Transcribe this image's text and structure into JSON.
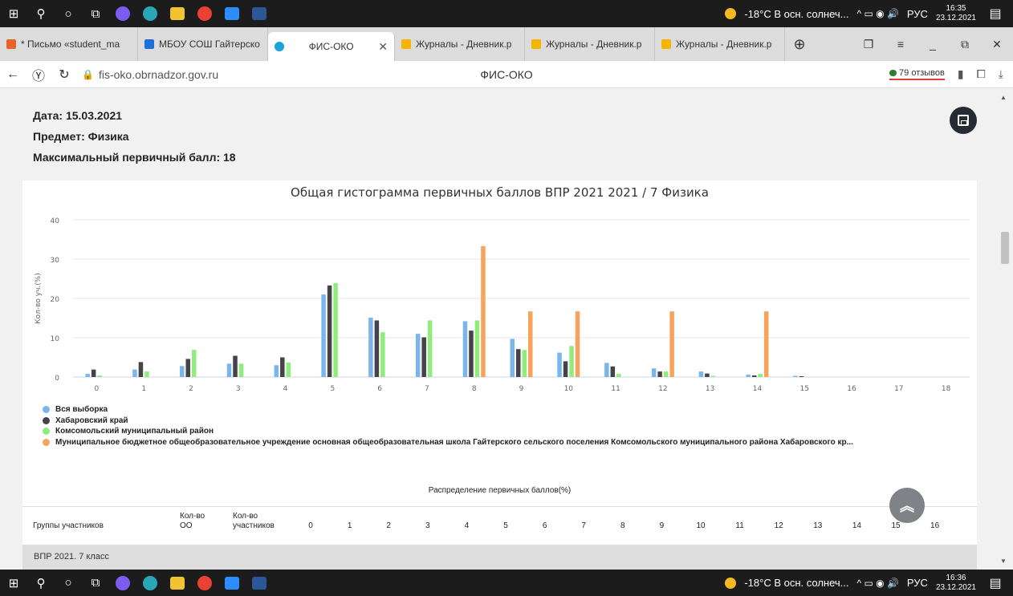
{
  "taskbar": {
    "weather": "-18°C В осн. солнеч...",
    "lang": "РУС",
    "top_time": "16:35",
    "top_date": "23.12.2021",
    "bottom_time": "16:36",
    "bottom_date": "23.12.2021"
  },
  "tabs": [
    {
      "label": "* Письмо «student_ma",
      "color": "#e8632b"
    },
    {
      "label": "МБОУ СОШ Гайтерско",
      "color": "#1e6fd9"
    },
    {
      "label": "ФИС-ОКО",
      "color": "#1aa3d8",
      "active": true
    },
    {
      "label": "Журналы - Дневник.р",
      "color": "#f4b400"
    },
    {
      "label": "Журналы - Дневник.р",
      "color": "#f4b400"
    },
    {
      "label": "Журналы - Дневник.р",
      "color": "#f4b400"
    }
  ],
  "address": {
    "url": "fis-oko.obrnadzor.gov.ru",
    "title": "ФИС-ОКО",
    "reviews": "79 отзывов"
  },
  "meta": {
    "date": "Дата: 15.03.2021",
    "subject": "Предмет: Физика",
    "max_score": "Максимальный первичный балл: 18"
  },
  "chart_data": {
    "type": "bar",
    "title": "Общая гистограмма первичных баллов ВПР 2021 2021 / 7 Физика",
    "ylabel": "Кол-во уч.(%)",
    "xlabel": "",
    "ylim": [
      0,
      40
    ],
    "yticks": [
      0,
      10,
      20,
      30,
      40
    ],
    "grid": true,
    "legend_position": "bottom-left",
    "categories": [
      "0",
      "1",
      "2",
      "3",
      "4",
      "5",
      "6",
      "7",
      "8",
      "9",
      "10",
      "11",
      "12",
      "13",
      "14",
      "15",
      "16",
      "17",
      "18"
    ],
    "series": [
      {
        "name": "Вся выборка",
        "color": "#7cb5ec",
        "values": [
          0.8,
          1.9,
          2.8,
          3.4,
          3.0,
          21.0,
          15.1,
          11.0,
          14.2,
          9.7,
          6.2,
          3.6,
          2.2,
          1.4,
          0.6,
          0.3,
          0,
          0,
          0
        ]
      },
      {
        "name": "Хабаровский край",
        "color": "#434348",
        "values": [
          1.9,
          3.8,
          4.6,
          5.4,
          5.0,
          23.3,
          14.4,
          10.1,
          11.8,
          7.1,
          4.0,
          2.7,
          1.4,
          0.9,
          0.4,
          0.2,
          0,
          0,
          0
        ]
      },
      {
        "name": "Комсомольский муниципальный район",
        "color": "#90ed7d",
        "values": [
          0.4,
          1.4,
          6.9,
          3.4,
          3.7,
          23.9,
          11.4,
          14.4,
          14.4,
          6.9,
          7.9,
          0.8,
          1.4,
          0.3,
          0.8,
          0,
          0,
          0,
          0
        ]
      },
      {
        "name": "Муниципальное бюджетное общеобразовательное учреждение основная общеобразовательная школа Гайтерского сельского поселения Комсомольского муниципального района Хабаровского кр...",
        "color": "#f7a35c",
        "values": [
          0,
          0,
          0,
          0,
          0,
          0,
          0,
          0,
          33.3,
          16.7,
          16.7,
          0,
          16.7,
          0,
          16.7,
          0,
          0,
          0,
          0
        ]
      }
    ]
  },
  "distribution_title": "Распределение первичных баллов(%)",
  "table": {
    "col_group": "Группы участников",
    "col_oo": "Кол-во ОО",
    "col_participants": "Кол-во участников",
    "score_cols": [
      "0",
      "1",
      "2",
      "3",
      "4",
      "5",
      "6",
      "7",
      "8",
      "9",
      "10",
      "11",
      "12",
      "13",
      "14",
      "15",
      "16"
    ]
  },
  "section_label": "ВПР 2021. 7 класс"
}
